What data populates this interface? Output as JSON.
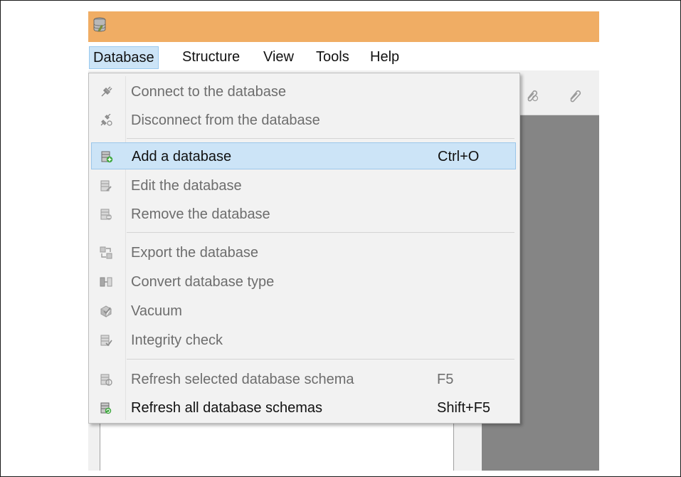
{
  "menubar": {
    "items": [
      {
        "label": "Database"
      },
      {
        "label": "Structure"
      },
      {
        "label": "View"
      },
      {
        "label": "Tools"
      },
      {
        "label": "Help"
      }
    ]
  },
  "database_menu": {
    "items": [
      {
        "label": "Connect to the database",
        "shortcut": "",
        "enabled": false,
        "icon": "plug-connect-icon"
      },
      {
        "label": "Disconnect from the database",
        "shortcut": "",
        "enabled": false,
        "icon": "plug-disconnect-icon"
      },
      {
        "label": "Add a database",
        "shortcut": "Ctrl+O",
        "enabled": true,
        "highlighted": true,
        "icon": "database-add-icon"
      },
      {
        "label": "Edit the database",
        "shortcut": "",
        "enabled": false,
        "icon": "database-edit-icon"
      },
      {
        "label": "Remove the database",
        "shortcut": "",
        "enabled": false,
        "icon": "database-remove-icon"
      },
      {
        "label": "Export the database",
        "shortcut": "",
        "enabled": false,
        "icon": "export-icon"
      },
      {
        "label": "Convert database type",
        "shortcut": "",
        "enabled": false,
        "icon": "convert-icon"
      },
      {
        "label": "Vacuum",
        "shortcut": "",
        "enabled": false,
        "icon": "vacuum-icon"
      },
      {
        "label": "Integrity check",
        "shortcut": "",
        "enabled": false,
        "icon": "integrity-check-icon"
      },
      {
        "label": "Refresh selected database schema",
        "shortcut": "F5",
        "enabled": false,
        "icon": "refresh-schema-icon"
      },
      {
        "label": "Refresh all database schemas",
        "shortcut": "Shift+F5",
        "enabled": true,
        "icon": "refresh-all-schemas-icon"
      }
    ]
  },
  "colors": {
    "titlebar": "#f0ad64",
    "highlight": "#cce4f7",
    "right_panel": "#858585"
  }
}
